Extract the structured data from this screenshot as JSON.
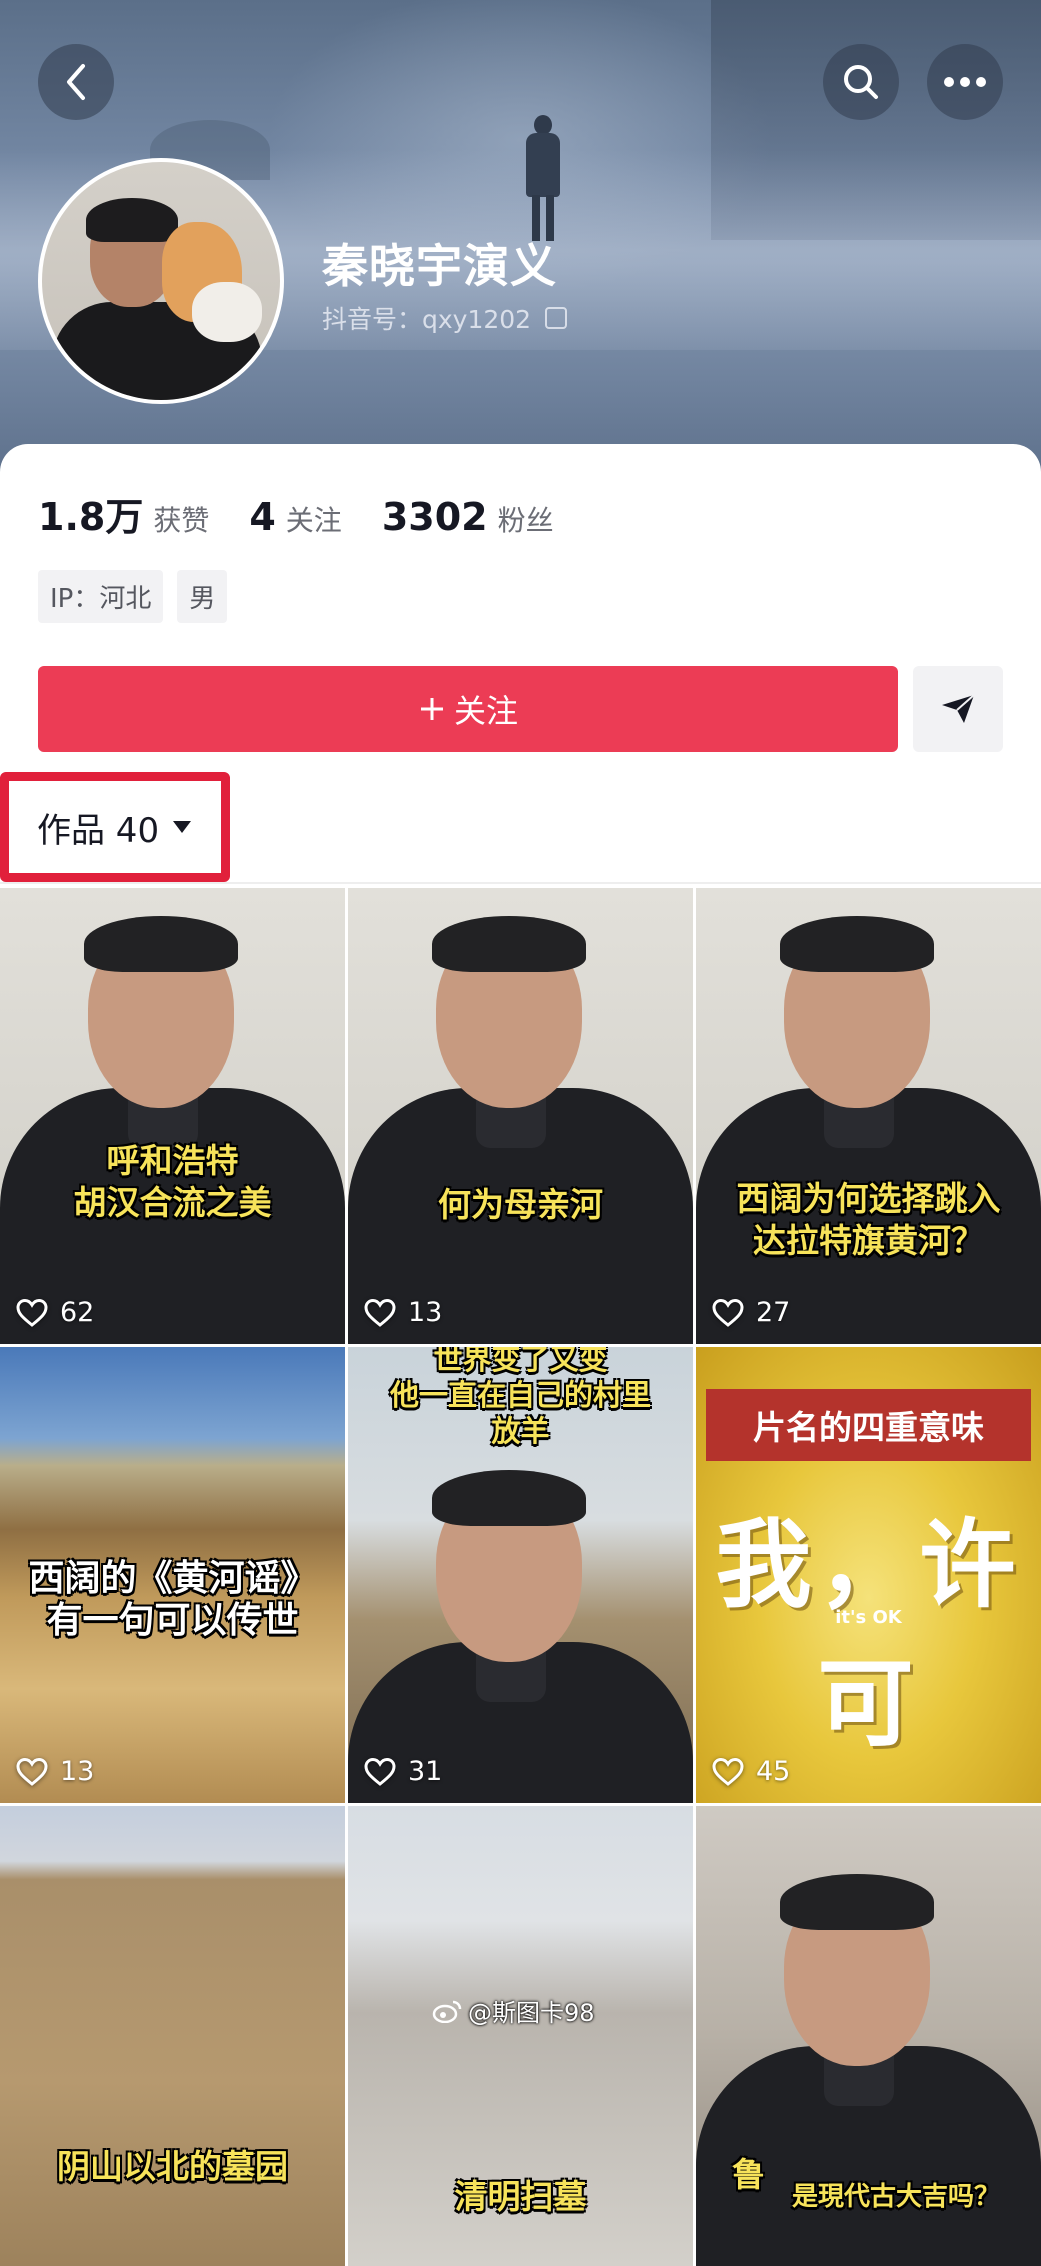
{
  "profile": {
    "nickname": "秦晓宇演义",
    "douyin_id": "抖音号：qxy1202",
    "stats": [
      {
        "value": "1.8万",
        "label": "获赞"
      },
      {
        "value": "4",
        "label": "关注"
      },
      {
        "value": "3302",
        "label": "粉丝"
      }
    ],
    "tags": [
      "IP：河北",
      "男"
    ],
    "follow_label": "关注",
    "works_tab_label": "作品 40"
  },
  "videos": [
    {
      "caption": [
        "呼和浩特",
        "胡汉合流之美"
      ],
      "likes": "62"
    },
    {
      "caption": [
        "何为母亲河"
      ],
      "likes": "13"
    },
    {
      "caption": [
        "西阔为何选择跳入",
        "达拉特旗黄河？"
      ],
      "likes": "27"
    },
    {
      "caption": [
        "西阔的《黄河谣》",
        "有一句可以传世"
      ],
      "likes": "13"
    },
    {
      "caption": [
        "世界变了又变",
        "他一直在自己的村里",
        "放羊"
      ],
      "likes": "31"
    },
    {
      "caption_box": "片名的四重意味",
      "big_text": "我，许可",
      "sub_text": "it's OK",
      "likes": "45"
    },
    {
      "caption": [
        "阴山以北的墓园"
      ]
    },
    {
      "caption": [
        "清明扫墓"
      ]
    },
    {
      "caption": [
        "鲁"
      ],
      "sub_caption": "是現代古大吉吗？"
    }
  ],
  "watermark": "@斯图卡98",
  "icons": {
    "back": "chevron-left-icon",
    "search": "search-icon",
    "more": "more-dots-icon",
    "copy": "copy-icon",
    "plus": "plus-icon",
    "share": "send-icon",
    "caret": "caret-down-icon",
    "like": "heart-icon",
    "weibo": "weibo-icon"
  },
  "colors": {
    "accent": "#ec3c55",
    "highlight_box": "#e1203b",
    "caption_yellow": "#f7e35a"
  }
}
